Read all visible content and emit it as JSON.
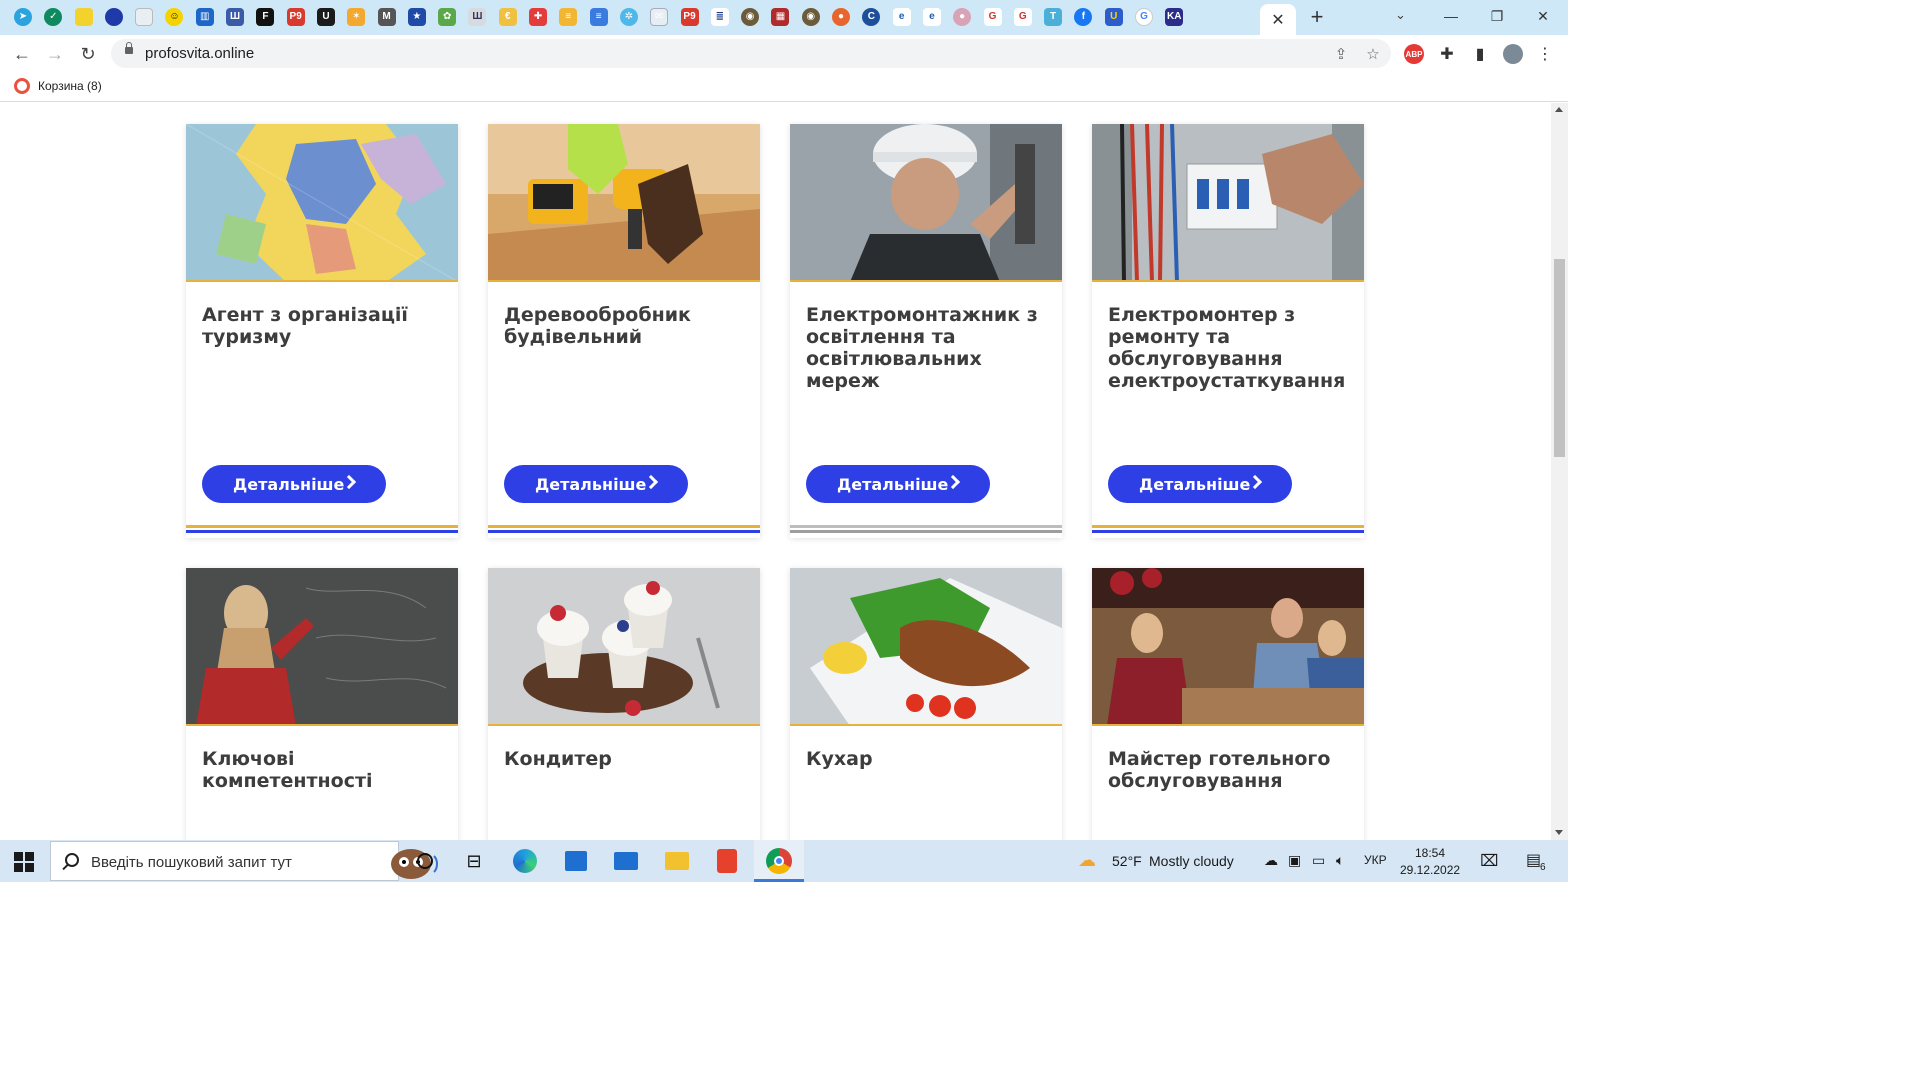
{
  "browser": {
    "active_tab_close": "✕",
    "new_tab_symbol": "+",
    "tab_search_symbol": "⌄",
    "url": "profosvita.online"
  },
  "bookmarks": [
    {
      "label": "Корзина (8)"
    }
  ],
  "cards": [
    {
      "title": "Агент з організації туризму",
      "button": "Детальніше"
    },
    {
      "title": "Деревообробник будівельний",
      "button": "Детальніше"
    },
    {
      "title": "Електромонтажник з освітлення та освітлювальних мереж",
      "button": "Детальніше"
    },
    {
      "title": "Електромонтер з ремонту та обслуговування електроустаткування",
      "button": "Детальніше"
    },
    {
      "title": "Ключові компетентності"
    },
    {
      "title": "Кондитер"
    },
    {
      "title": "Кухар"
    },
    {
      "title": "Майстер готельного обслуговування"
    }
  ],
  "taskbar": {
    "search_placeholder": "Введіть пошуковий запит тут",
    "weather_temp": "52°F",
    "weather_text": "Mostly cloudy",
    "language": "УКР",
    "time": "18:54",
    "date": "29.12.2022",
    "notification_count": "6"
  },
  "colors": {
    "accent_button": "#2e3fe6",
    "tab_strip": "#cfe8f7",
    "stripe_gold": "#e7b23a",
    "stripe_blue": "#2e3fe6"
  }
}
